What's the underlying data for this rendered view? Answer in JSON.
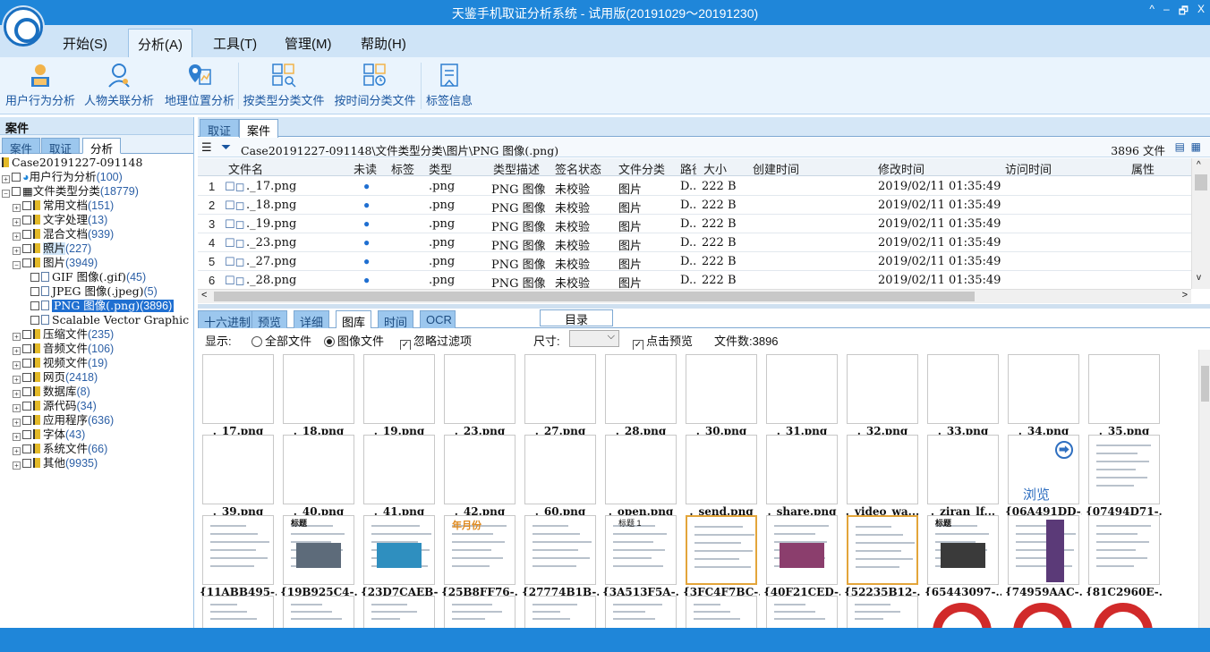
{
  "window": {
    "title": "天鉴手机取证分析系统 - 试用版(20191029～20191230)",
    "controls": [
      "^",
      "–",
      "🗗",
      "X"
    ]
  },
  "menu": [
    "开始(S)",
    "分析(A)",
    "工具(T)",
    "管理(M)",
    "帮助(H)"
  ],
  "ribbon": [
    "用户行为分析",
    "人物关联分析",
    "地理位置分析",
    "按类型分类文件",
    "按时间分类文件",
    "标签信息"
  ],
  "left": {
    "header": "案件",
    "tabs": [
      "案件",
      "取证",
      "分析"
    ],
    "tree": [
      {
        "label": "Case20191227-091148",
        "count": ""
      },
      {
        "label": "用户行为分析",
        "count": "(100)"
      },
      {
        "label": "文件类型分类",
        "count": "(18779)"
      },
      {
        "label": "常用文档",
        "count": "(151)"
      },
      {
        "label": "文字处理",
        "count": "(13)"
      },
      {
        "label": "混合文档",
        "count": "(939)"
      },
      {
        "label": "照片",
        "count": "(227)"
      },
      {
        "label": "图片",
        "count": "(3949)"
      },
      {
        "label": "GIF 图像(.gif)",
        "count": "(45)"
      },
      {
        "label": "JPEG 图像(.jpeg)",
        "count": "(5)"
      },
      {
        "label": "PNG 图像(.png)",
        "count": "(3896)"
      },
      {
        "label": "Scalable Vector Graphic",
        "count": ""
      },
      {
        "label": "压缩文件",
        "count": "(235)"
      },
      {
        "label": "音频文件",
        "count": "(106)"
      },
      {
        "label": "视频文件",
        "count": "(19)"
      },
      {
        "label": "网页",
        "count": "(2418)"
      },
      {
        "label": "数据库",
        "count": "(8)"
      },
      {
        "label": "源代码",
        "count": "(34)"
      },
      {
        "label": "应用程序",
        "count": "(636)"
      },
      {
        "label": "字体",
        "count": "(43)"
      },
      {
        "label": "系统文件",
        "count": "(66)"
      },
      {
        "label": "其他",
        "count": "(9935)"
      }
    ]
  },
  "main": {
    "tabs": [
      "取证",
      "案件"
    ],
    "path": "Case20191227-091148\\文件类型分类\\图片\\PNG 图像(.png)",
    "file_count": "3896 文件",
    "columns": [
      "文件名",
      "未读",
      "标签",
      "类型",
      "类型描述",
      "签名状态",
      "文件分类",
      "路径",
      "大小",
      "创建时间",
      "修改时间",
      "访问时间",
      "属性"
    ],
    "rows": [
      {
        "n": "1",
        "name": "._17.png",
        "unread": "●",
        "type": ".png",
        "desc": "PNG 图像",
        "sig": "未校验",
        "cat": "图片",
        "path": "D..",
        "size": "222 B",
        "mtime": "2019/02/11 01:35:49"
      },
      {
        "n": "2",
        "name": "._18.png",
        "unread": "●",
        "type": ".png",
        "desc": "PNG 图像",
        "sig": "未校验",
        "cat": "图片",
        "path": "D..",
        "size": "222 B",
        "mtime": "2019/02/11 01:35:49"
      },
      {
        "n": "3",
        "name": "._19.png",
        "unread": "●",
        "type": ".png",
        "desc": "PNG 图像",
        "sig": "未校验",
        "cat": "图片",
        "path": "D..",
        "size": "222 B",
        "mtime": "2019/02/11 01:35:49"
      },
      {
        "n": "4",
        "name": "._23.png",
        "unread": "●",
        "type": ".png",
        "desc": "PNG 图像",
        "sig": "未校验",
        "cat": "图片",
        "path": "D..",
        "size": "222 B",
        "mtime": "2019/02/11 01:35:49"
      },
      {
        "n": "5",
        "name": "._27.png",
        "unread": "●",
        "type": ".png",
        "desc": "PNG 图像",
        "sig": "未校验",
        "cat": "图片",
        "path": "D..",
        "size": "222 B",
        "mtime": "2019/02/11 01:35:49"
      },
      {
        "n": "6",
        "name": "._28.png",
        "unread": "●",
        "type": ".png",
        "desc": "PNG 图像",
        "sig": "未校验",
        "cat": "图片",
        "path": "D..",
        "size": "222 B",
        "mtime": "2019/02/11 01:35:49"
      }
    ]
  },
  "lower": {
    "tabs": [
      "十六进制",
      "预览",
      "详细",
      "图库",
      "时间",
      "OCR"
    ],
    "dir_button": "目录",
    "show_label": "显示:",
    "radio_all": "全部文件",
    "radio_img": "图像文件",
    "ignore_filter": "忽略过滤项",
    "size_label": "尺寸:",
    "click_preview": "点击预览",
    "file_count_label": "文件数:3896",
    "browse_label": "浏览",
    "thumbs_row1": [
      "._17.png",
      "._18.png",
      "._19.png",
      "._23.png",
      "._27.png",
      "._28.png",
      "._30.png",
      "._31.png",
      "._32.png",
      "._33.png",
      "._34.png",
      "._35.png"
    ],
    "thumbs_row2": [
      "._39.png",
      "._40.png",
      "._41.png",
      "._42.png",
      "._60.png",
      "._open.png",
      "._send.png",
      "._share.png",
      "._video_wa...",
      "._ziran_lf...",
      "{06A491DD-...",
      "{07494D71-..."
    ],
    "thumbs_row3": [
      "{11ABB495-...",
      "{19B925C4-...",
      "{23D7CAEB-...",
      "{25B8FF76-...",
      "{27774B1B-...",
      "{3A513F5A-...",
      "{3FC4F7BC-...",
      "{40F21CED-...",
      "{52235B12-...",
      "{65443097-...",
      "{74959AAC-...",
      "{81C2960E-..."
    ],
    "month_label": "年月份",
    "title_text": "标题",
    "title1_text": "标题 1"
  },
  "colors": {
    "accent": "#1f86d9",
    "selected": "#1f6fd1",
    "tab_inactive": "#9cc7ee"
  }
}
